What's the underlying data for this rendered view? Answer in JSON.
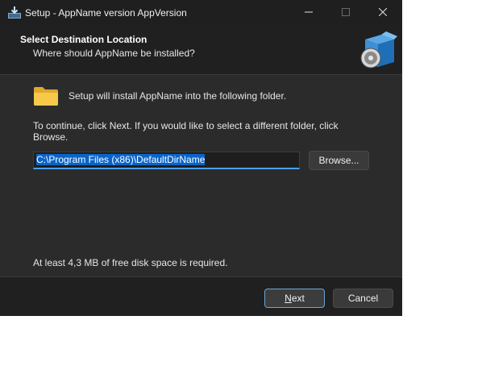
{
  "window": {
    "title": "Setup - AppName version AppVersion"
  },
  "header": {
    "title": "Select Destination Location",
    "subtitle": "Where should AppName be installed?"
  },
  "main": {
    "intro": "Setup will install AppName into the following folder.",
    "continue_text": "To continue, click Next. If you would like to select a different folder, click Browse.",
    "path_value": "C:\\Program Files (x86)\\DefaultDirName",
    "browse_label": "Browse...",
    "disk_space": "At least 4,3 MB of free disk space is required."
  },
  "footer": {
    "next_label_accel": "N",
    "next_label_rest": "ext",
    "cancel_label": "Cancel"
  },
  "icons": [
    "setup-app-icon",
    "minimize-icon",
    "maximize-icon",
    "close-icon",
    "installer-box-icon",
    "folder-icon"
  ],
  "colors": {
    "window_bg": "#2b2b2b",
    "header_bg": "#202020",
    "selection": "#0a64c8",
    "focus_accent": "#4aa0ff"
  }
}
